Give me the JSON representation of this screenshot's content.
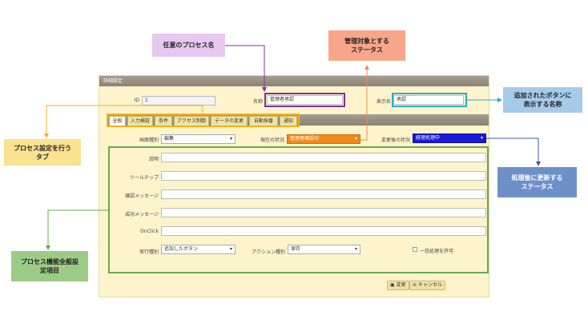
{
  "panel": {
    "title": "詳細設定"
  },
  "fields": {
    "id": {
      "label": "ID",
      "value": "1"
    },
    "name": {
      "label": "名称",
      "value": "管理者承認"
    },
    "display_name": {
      "label": "表示名",
      "value": "承認"
    }
  },
  "tabs": [
    "全般",
    "入力検証",
    "条件",
    "アクセス制御",
    "データの変更",
    "自動採番",
    "通知"
  ],
  "general": {
    "screen_type": {
      "label": "画面種別",
      "value": "編集"
    },
    "current_status": {
      "label": "現在の状況",
      "value": "管理者確認中"
    },
    "after_status": {
      "label": "変更後の状況",
      "value": "経理処理中"
    },
    "description": {
      "label": "説明"
    },
    "tooltip": {
      "label": "ツールチップ"
    },
    "confirm_message": {
      "label": "確認メッセージ"
    },
    "success_message": {
      "label": "成功メッセージ"
    },
    "onclick": {
      "label": "OnClick"
    },
    "exec_type": {
      "label": "実行種別",
      "value": "追加したボタン"
    },
    "action_type": {
      "label": "アクション種別",
      "value": "保存"
    },
    "allow_bulk": {
      "label": "一括処理を許可"
    }
  },
  "buttons": {
    "change": "変更",
    "cancel": "キャンセル"
  },
  "annotations": {
    "process_name": "任意のプロセス名",
    "target_status": "管理対象とする\nステータス",
    "button_name": "追加されたボタンに\n表示する名称",
    "process_tab": "プロセス設定を行う\nタブ",
    "updated_status": "処理後に更新する\nステータス",
    "general_items": "プロセス機能全般設\n定項目"
  },
  "colors": {
    "purple": "#7b2fa0",
    "salmon": "#f08a5d",
    "cyan": "#2aa8d8",
    "yellow": "#f2b01e",
    "navy": "#3a5ca8",
    "green": "#6aa84f"
  }
}
